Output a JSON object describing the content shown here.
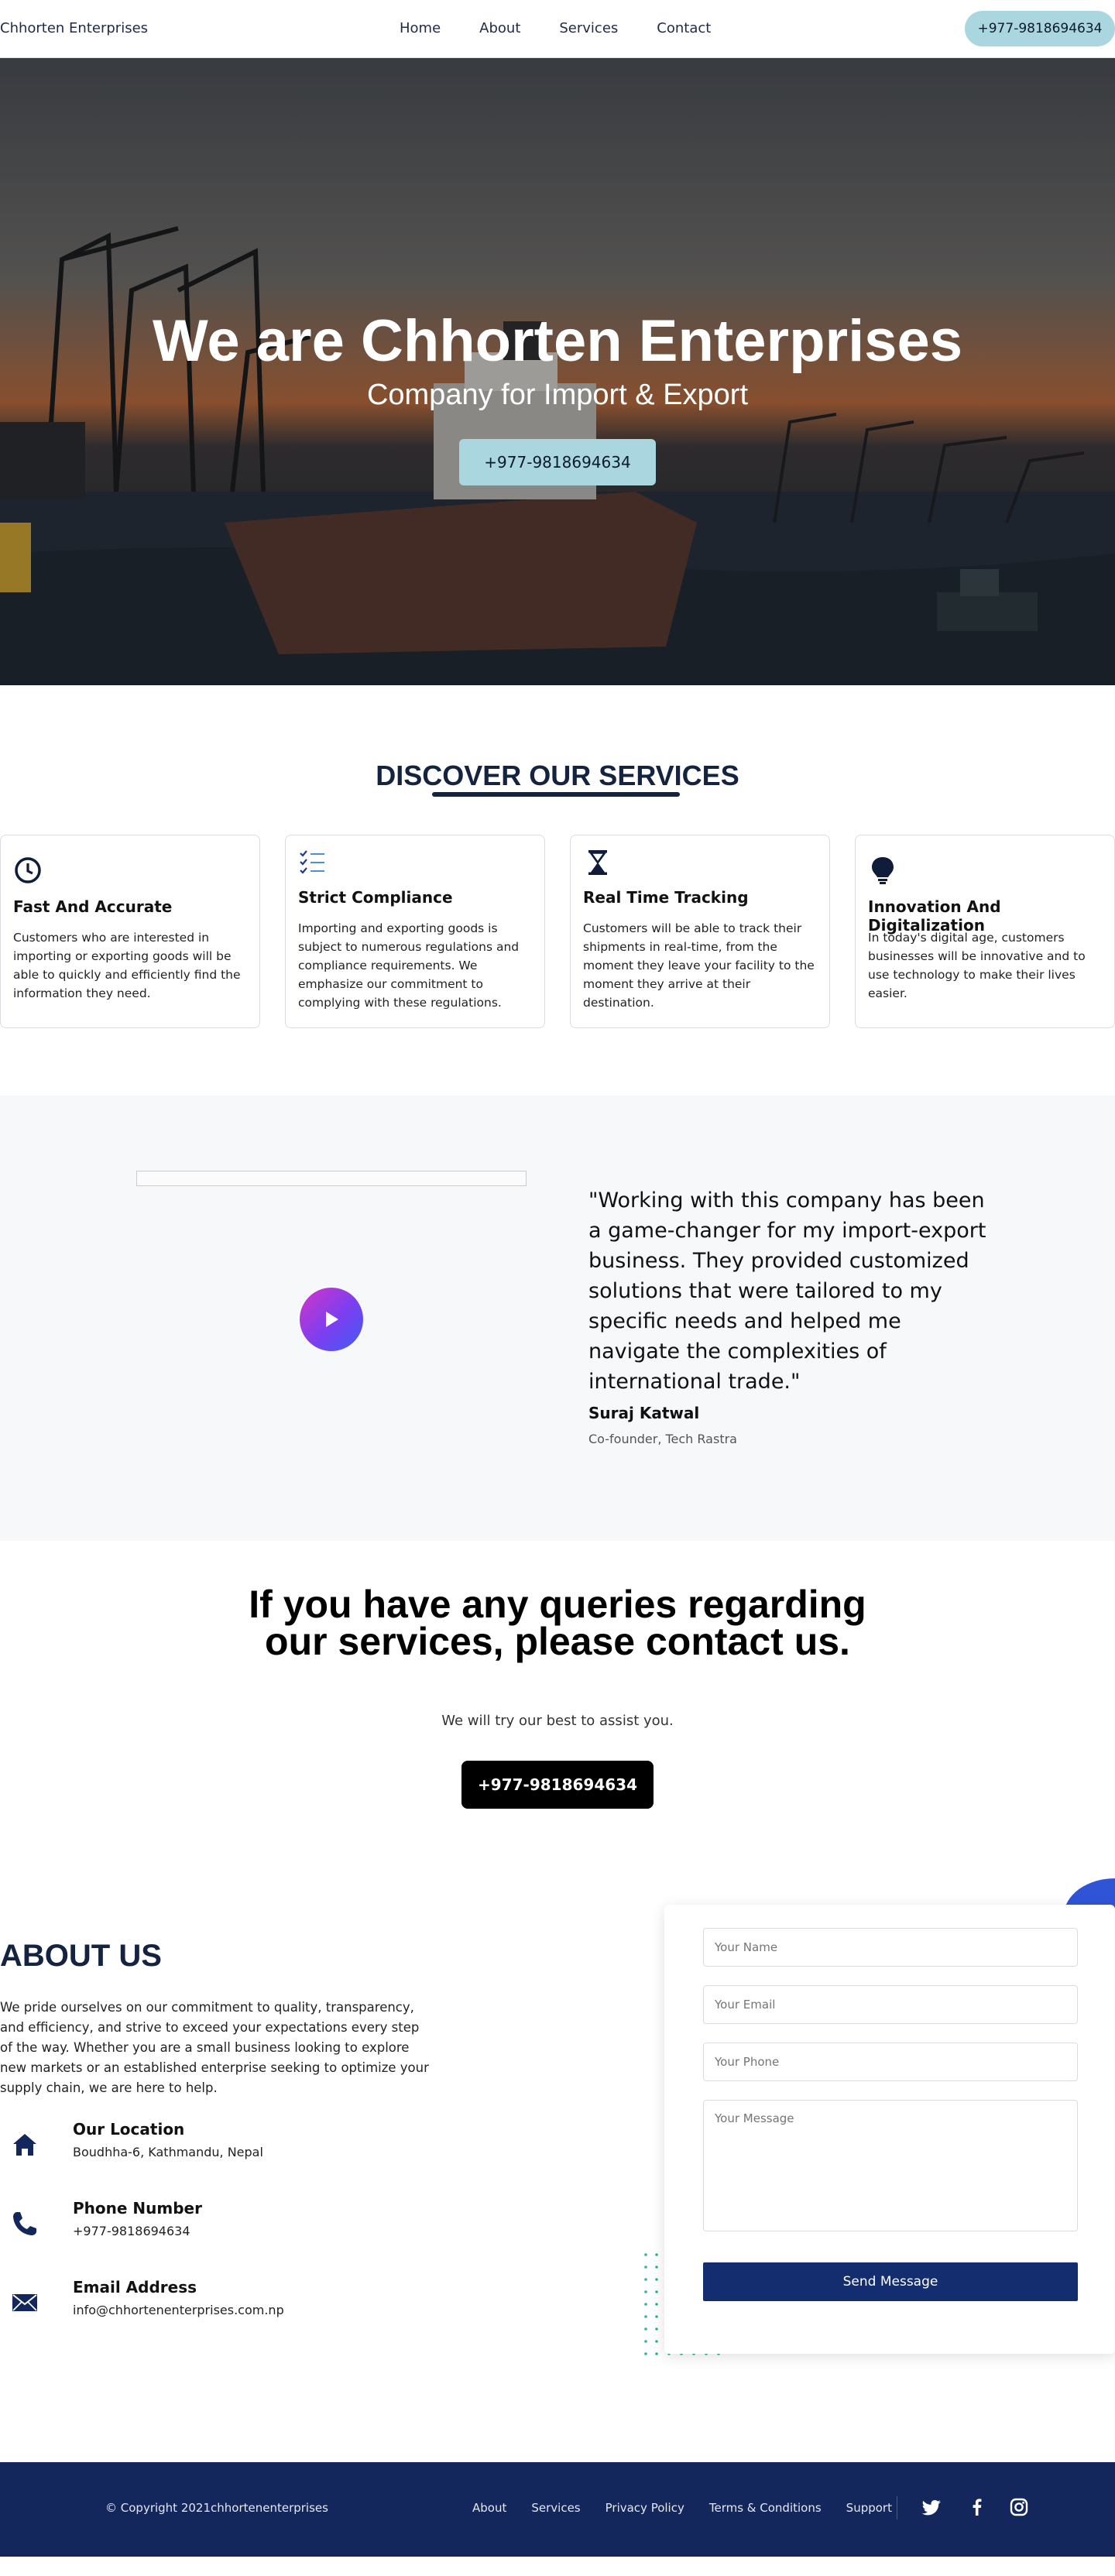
{
  "nav": {
    "brand": "Chhorten Enterprises",
    "links": [
      "Home",
      "About",
      "Services",
      "Contact"
    ],
    "phone": "+977-9818694634"
  },
  "hero": {
    "title": "We are Chhorten Enterprises",
    "subtitle": "Company for Import & Export",
    "phone": "+977-9818694634"
  },
  "services": {
    "heading": "DISCOVER OUR SERVICES",
    "cards": [
      {
        "icon": "clock-icon",
        "title": "Fast And Accurate",
        "text": "Customers who are interested in importing or exporting goods will be able to quickly and efficiently find the information they need."
      },
      {
        "icon": "checklist-icon",
        "title": "Strict Compliance",
        "text": "Importing and exporting goods is subject to numerous regulations and compliance requirements. We emphasize our commitment to complying with these regulations."
      },
      {
        "icon": "hourglass-icon",
        "title": "Real Time Tracking",
        "text": "Customers will be able to track their shipments in real-time, from the moment they leave your facility to the moment they arrive at their destination."
      },
      {
        "icon": "lightbulb-icon",
        "title": "Innovation And Digitalization",
        "text": "In today's digital age, customers businesses will be innovative and to use technology to make their lives easier."
      }
    ]
  },
  "testimonial": {
    "quote": "\"Working with this company has been a game-changer for my import-export business. They provided customized solutions that were tailored to my specific needs and helped me navigate the complexities of international trade.\"",
    "name": "Suraj Katwal",
    "role": "Co-founder, Tech Rastra"
  },
  "cta": {
    "heading": "If you have any queries regarding our services, please contact us.",
    "note": "We will try our best to assist you.",
    "phone": "+977-9818694634"
  },
  "about": {
    "heading": "ABOUT US",
    "text": "We pride ourselves on our commitment to quality, transparency, and efficiency, and strive to exceed your expectations every step of the way. Whether you are a small business looking to explore new markets or an established enterprise seeking to optimize your supply chain, we are here to help.",
    "location_title": "Our Location",
    "location": "Boudhha-6, Kathmandu, Nepal",
    "phone_title": "Phone Number",
    "phone": "+977-9818694634",
    "email_title": "Email Address",
    "email": "info@chhortenenterprises.com.np"
  },
  "form": {
    "name_placeholder": "Your Name",
    "email_placeholder": "Your Email",
    "phone_placeholder": "Your Phone",
    "message_placeholder": "Your Message",
    "send_label": "Send Message"
  },
  "footer": {
    "copyright": "© Copyright 2021chhortenenterprises",
    "links": [
      "About",
      "Services",
      "Privacy Policy",
      "Terms & Conditions",
      "Support"
    ]
  },
  "colors": {
    "accent": "#a9d6df",
    "navy": "#14233f",
    "footer": "#14275c",
    "button": "#142d6e"
  }
}
